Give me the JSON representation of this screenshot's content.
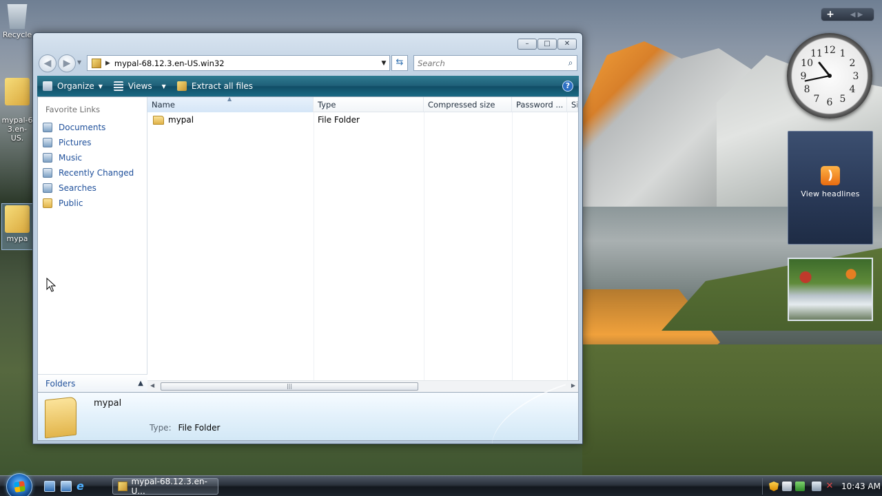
{
  "desktop": {
    "icons": [
      {
        "label": "Recycle",
        "name": "recycle-bin"
      },
      {
        "label": "mypal-6\n3.en-US.",
        "name": "mypal-zip"
      },
      {
        "label": "mypa",
        "name": "mypal-selected"
      }
    ]
  },
  "gadgets": {
    "toolbar_plus": "+",
    "clock": {
      "hour": 10,
      "minute": 43
    },
    "clock_numbers": [
      "12",
      "1",
      "2",
      "3",
      "4",
      "5",
      "6",
      "7",
      "8",
      "9",
      "10",
      "11"
    ],
    "rss_label": "View headlines"
  },
  "window": {
    "caption_buttons": {
      "minimize": "–",
      "maximize": "□",
      "close": "✕"
    },
    "address": "mypal-68.12.3.en-US.win32",
    "search_placeholder": "Search",
    "toolbar": {
      "organize": "Organize",
      "views": "Views",
      "extract": "Extract all files",
      "help": "?"
    },
    "nav": {
      "title": "Favorite Links",
      "items": [
        {
          "label": "Documents",
          "icon": "documents-icon"
        },
        {
          "label": "Pictures",
          "icon": "pictures-icon"
        },
        {
          "label": "Music",
          "icon": "music-icon"
        },
        {
          "label": "Recently Changed",
          "icon": "recently-changed-icon"
        },
        {
          "label": "Searches",
          "icon": "searches-icon"
        },
        {
          "label": "Public",
          "icon": "public-folder-icon"
        }
      ],
      "folders_label": "Folders"
    },
    "columns": {
      "name": "Name",
      "type": "Type",
      "compressed": "Compressed size",
      "password": "Password ...",
      "more": "Si"
    },
    "rows": [
      {
        "name": "mypal",
        "type": "File Folder"
      }
    ],
    "details": {
      "name": "mypal",
      "type_label": "Type:",
      "type_value": "File Folder"
    }
  },
  "taskbar": {
    "task_label": "mypal-68.12.3.en-U...",
    "time": "10:43 AM"
  }
}
